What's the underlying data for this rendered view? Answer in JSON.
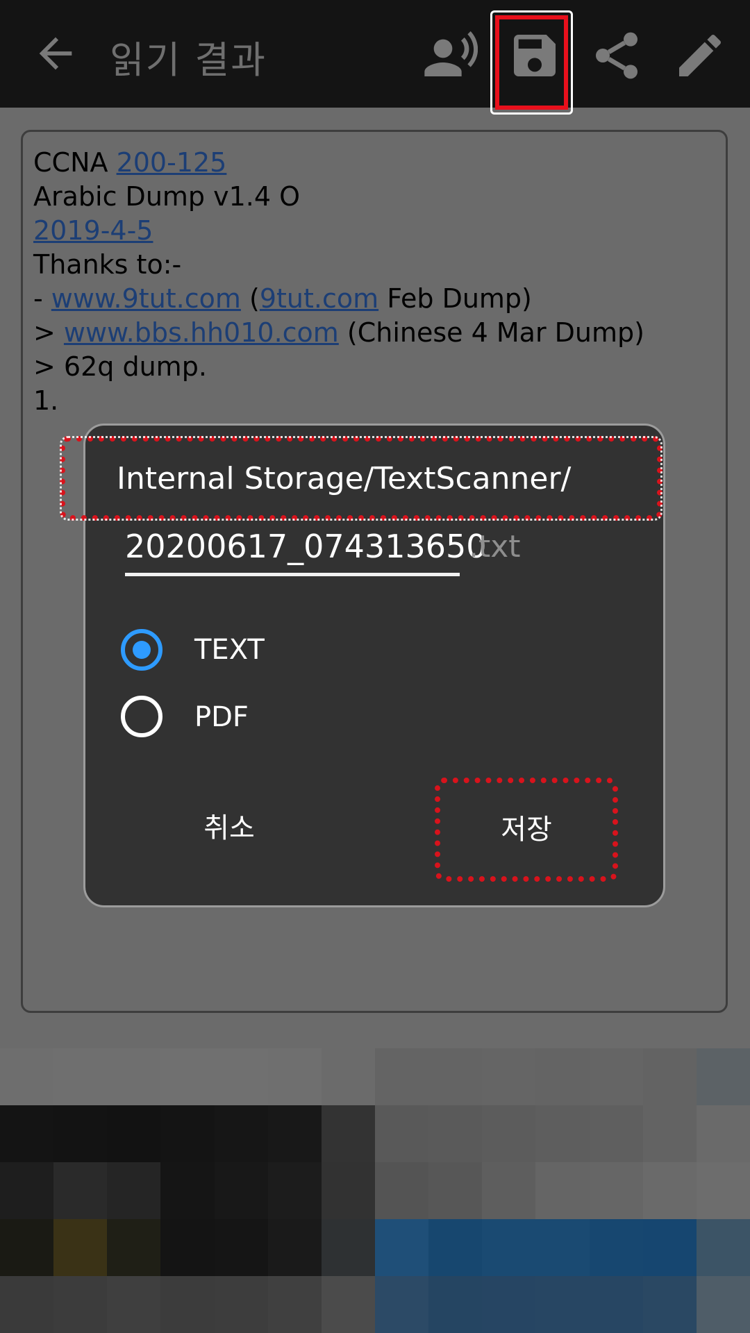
{
  "appbar": {
    "title": "읽기 결과",
    "icons": [
      "back-arrow-icon",
      "text-to-speech-icon",
      "save-icon",
      "share-icon",
      "edit-icon"
    ]
  },
  "ocr_text": {
    "l1_a": "CCNA ",
    "l1_link": "200-125",
    "l2": "Arabic Dump v1.4 O",
    "l3_link": "2019-4-5",
    "l4": "Thanks to:-",
    "l5_a": "- ",
    "l5_link1": "www.9tut.com",
    "l5_b": " (",
    "l5_link2": "9tut.com",
    "l5_c": " Feb Dump)",
    "l6_a": "> ",
    "l6_link": "www.bbs.hh010.com",
    "l6_b": " (Chinese 4 Mar Dump)",
    "l7": "> 62q dump.",
    "l8": "1."
  },
  "save_dialog": {
    "path": "Internal Storage/TextScanner/",
    "filename": "20200617_074313650",
    "extension": ".txt",
    "formats": [
      {
        "label": "TEXT",
        "selected": true
      },
      {
        "label": "PDF",
        "selected": false
      }
    ],
    "cancel_label": "취소",
    "save_label": "저장"
  },
  "colors": {
    "appbar": "#141414",
    "dialog": "#323232",
    "radio_selected": "#2e9bff",
    "highlight": "#e8101c"
  }
}
